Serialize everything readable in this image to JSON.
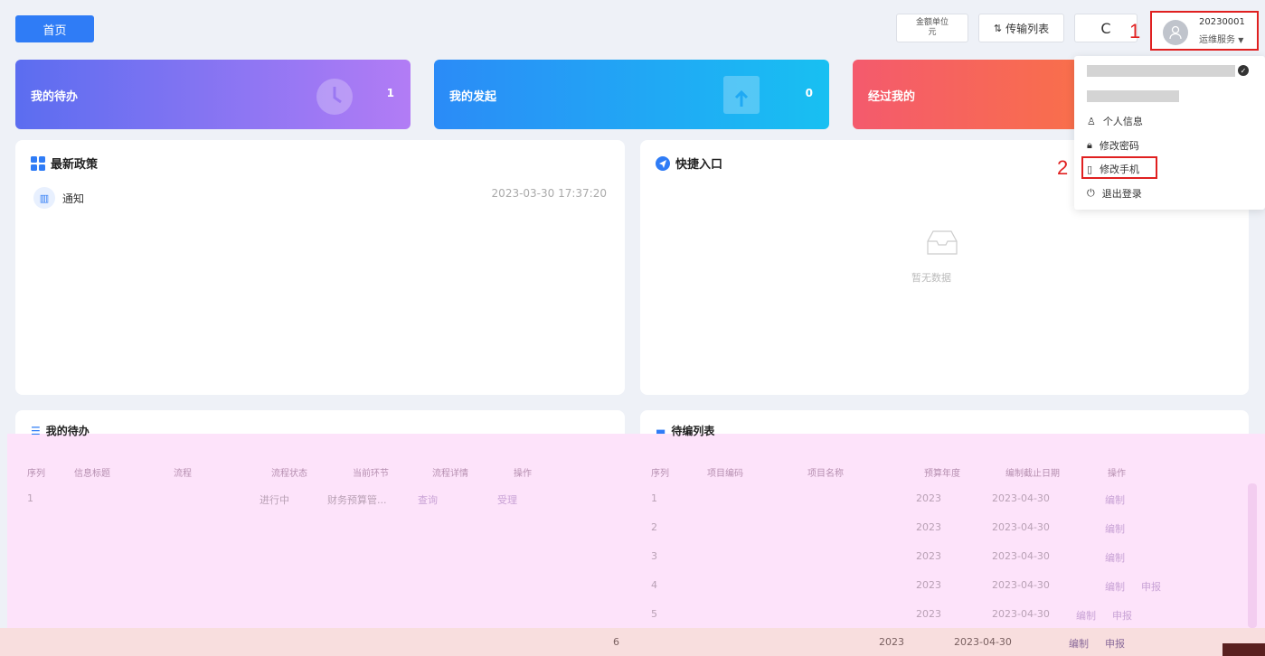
{
  "header": {
    "home_label": "首页",
    "unit_line1": "金额单位",
    "unit_line2": "元",
    "transfer_label": "传输列表",
    "refresh_symbol": "C",
    "user_id": "20230001",
    "user_role": "运维服务",
    "annotation_1": "1",
    "annotation_2": "2"
  },
  "stats": {
    "todo_label": "我的待办",
    "todo_count": "1",
    "initiated_label": "我的发起",
    "initiated_count": "0",
    "passed_label": "经过我的"
  },
  "policy": {
    "title": "最新政策",
    "item_label": "通知",
    "item_date": "2023-03-30 17:37:20"
  },
  "quick": {
    "title": "快捷入口",
    "empty_text": "暂无数据"
  },
  "user_menu": {
    "items": [
      "个人信息",
      "修改密码",
      "修改手机",
      "退出登录"
    ]
  },
  "todo_table": {
    "title": "我的待办",
    "columns": [
      "序列",
      "信息标题",
      "流程",
      "流程状态",
      "当前环节",
      "流程详情",
      "操作"
    ],
    "rows": [
      [
        "1",
        "",
        "",
        "进行中",
        "财务预算管...",
        "查询",
        "受理"
      ]
    ]
  },
  "compile_table": {
    "title": "待编列表",
    "columns": [
      "序列",
      "项目编码",
      "项目名称",
      "预算年度",
      "编制截止日期",
      "操作"
    ],
    "rows": [
      {
        "no": "1",
        "year": "2023",
        "deadline": "2023-04-30",
        "action": "编制"
      },
      {
        "no": "2",
        "year": "2023",
        "deadline": "2023-04-30",
        "action": "编制"
      },
      {
        "no": "3",
        "year": "2023",
        "deadline": "2023-04-30",
        "action": "编制"
      },
      {
        "no": "4",
        "year": "2023",
        "deadline": "2023-04-30",
        "action": "编制",
        "action2": "申报"
      },
      {
        "no": "5",
        "year": "2023",
        "deadline": "2023-04-30",
        "action": "编制",
        "action2": "申报"
      },
      {
        "no": "6",
        "year": "2023",
        "deadline": "2023-04-30",
        "action": "编制",
        "action2": "申报"
      }
    ]
  },
  "colors": {
    "primary": "#2f7cf6",
    "highlight": "#e02020"
  }
}
